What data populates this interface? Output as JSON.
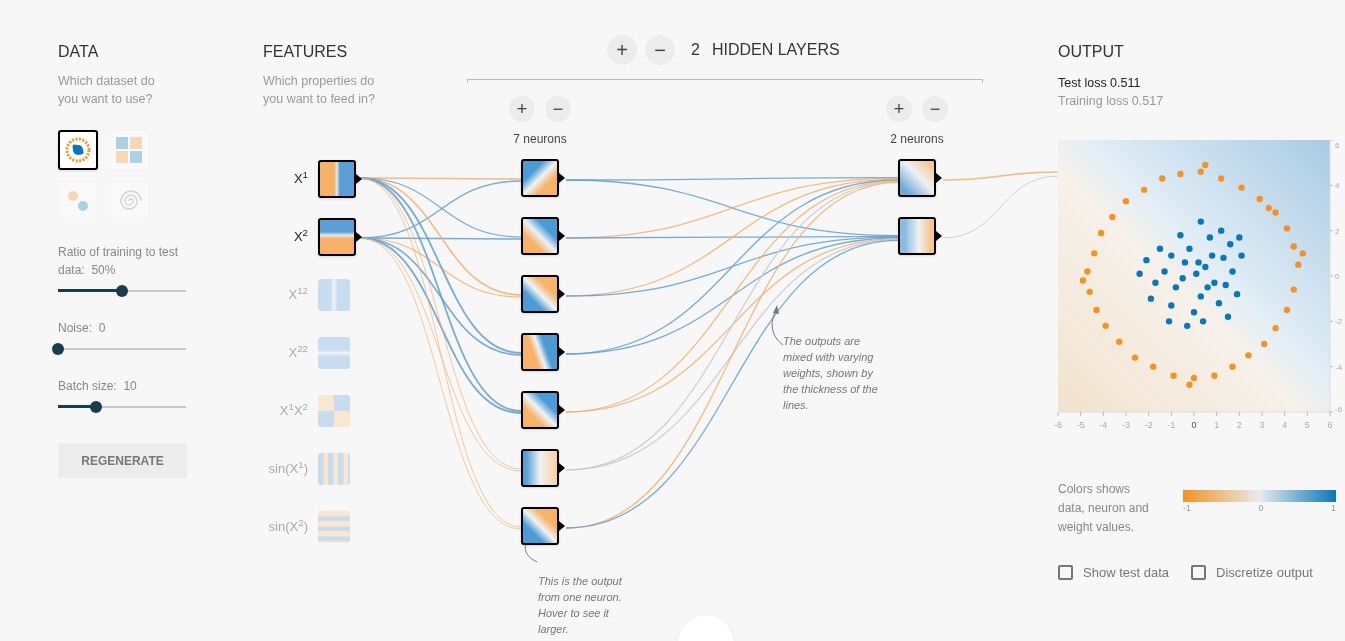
{
  "data": {
    "title": "DATA",
    "subtitle": "Which dataset do you want to use?",
    "datasets": [
      {
        "kind": "circle",
        "selected": true
      },
      {
        "kind": "xor",
        "selected": false
      },
      {
        "kind": "gauss",
        "selected": false
      },
      {
        "kind": "spiral",
        "selected": false
      }
    ],
    "sliders": [
      {
        "label": "Ratio of training to test data:",
        "value": "50%",
        "level": 0.5
      },
      {
        "label": "Noise:",
        "value": "0",
        "level": 0
      },
      {
        "label": "Batch size:",
        "value": "10",
        "level": 0.3
      }
    ],
    "regenerate_button": "REGENERATE"
  },
  "features": {
    "title": "FEATURES",
    "subtitle": "Which properties do you want to feed in?",
    "items": [
      {
        "label": "X$^{1}$",
        "kind": "x1",
        "selected": true
      },
      {
        "label": "X$^{2}$",
        "kind": "x2",
        "selected": true
      },
      {
        "label": "X$^{12}$",
        "kind": "x1sq",
        "selected": false
      },
      {
        "label": "X$^{22}$",
        "kind": "x2sq",
        "selected": false
      },
      {
        "label": "X$^{1}$X$^{2}$",
        "kind": "x1x2",
        "selected": false
      },
      {
        "label": "sin(X$^{1}$)",
        "kind": "sinx1",
        "selected": false
      },
      {
        "label": "sin(X$^{2}$)",
        "kind": "sinx2",
        "selected": false
      }
    ]
  },
  "network": {
    "add_layer": "+",
    "remove_layer": "−",
    "layer_count": "2",
    "title": "HIDDEN LAYERS",
    "layers": [
      {
        "add": "+",
        "remove": "−",
        "neurons_label": "7 neurons",
        "neurons": [
          {
            "kind": "nw-blue"
          },
          {
            "kind": "ne-blue"
          },
          {
            "kind": "sw-blue"
          },
          {
            "kind": "e-blue"
          },
          {
            "kind": "ne-blue"
          },
          {
            "kind": "w-blue"
          },
          {
            "kind": "sw-blue"
          }
        ]
      },
      {
        "add": "+",
        "remove": "−",
        "neurons_label": "2 neurons",
        "neurons": [
          {
            "kind": "sw-pale"
          },
          {
            "kind": "w-pale"
          }
        ]
      }
    ],
    "notes": [
      "This is the output from one neuron. Hover to see it larger.",
      "The outputs are mixed with varying weights, shown by the thickness of the lines."
    ]
  },
  "output": {
    "title": "OUTPUT",
    "test_loss": "Test loss 0.511",
    "training_loss": "Training loss 0.517",
    "chart_data": {
      "type": "scatter",
      "xlim": [
        -6,
        6
      ],
      "ylim": [
        -6,
        6
      ],
      "yticks": [
        -6,
        -4,
        -2,
        0,
        2,
        4,
        6
      ],
      "xticks": [
        -6,
        -5,
        -4,
        -3,
        -2,
        -1,
        0,
        1,
        2,
        3,
        4,
        5,
        6
      ],
      "series": [
        {
          "color": "#f59322",
          "x": [
            4.6,
            4.4,
            4.1,
            3.6,
            2.9,
            2.1,
            1.2,
            0.3,
            -0.6,
            -1.4,
            -2.2,
            -3.0,
            -3.6,
            -4.1,
            -4.4,
            -4.7,
            -4.6,
            -4.3,
            -3.9,
            -3.3,
            -2.6,
            -1.8,
            -0.9,
            0.0,
            0.9,
            1.7,
            2.4,
            3.1,
            3.6,
            4.1,
            4.4,
            4.8,
            -4.9,
            0.5,
            -0.2,
            3.3
          ],
          "values": [
            0.5,
            1.3,
            2.1,
            2.8,
            3.4,
            3.9,
            4.3,
            4.6,
            4.5,
            4.3,
            3.8,
            3.3,
            2.6,
            1.9,
            1.0,
            0.2,
            -0.7,
            -1.5,
            -2.2,
            -2.9,
            -3.6,
            -4.0,
            -4.4,
            -4.5,
            -4.4,
            -4.0,
            -3.5,
            -3.0,
            -2.3,
            -1.5,
            -0.6,
            1.0,
            -0.2,
            4.9,
            -4.8,
            3.0
          ]
        },
        {
          "color": "#0877bd",
          "x": [
            0.1,
            0.5,
            -0.4,
            0.9,
            -0.8,
            0.3,
            -0.2,
            1.3,
            -1.3,
            1.1,
            -1.0,
            0.0,
            1.7,
            -1.7,
            0.7,
            -0.6,
            1.6,
            -1.5,
            1.9,
            -1.9,
            0.4,
            -0.3,
            2.1,
            -2.1,
            1.2,
            -1.1,
            0.8,
            -0.5,
            0.2,
            0.6,
            -1.0,
            1.4,
            2.0,
            -2.4,
            0.3,
            1.5
          ],
          "values": [
            0.1,
            0.4,
            0.6,
            -0.3,
            -0.5,
            -0.9,
            1.2,
            0.8,
            0.2,
            -1.2,
            -1.3,
            -1.6,
            0.2,
            -0.3,
            1.7,
            1.8,
            1.4,
            1.2,
            -0.8,
            -1.0,
            -2.0,
            -2.2,
            0.9,
            0.7,
            2.0,
            -2.0,
            0.9,
            -0.1,
            0.6,
            -0.5,
            0.9,
            -0.4,
            1.7,
            0.1,
            2.4,
            -1.8
          ]
        }
      ]
    },
    "legend": {
      "text": "Colors shows data, neuron and weight values.",
      "ticks": [
        "-1",
        "0",
        "1"
      ]
    },
    "checkboxes": [
      {
        "label": "Show test data",
        "checked": false
      },
      {
        "label": "Discretize output",
        "checked": false
      }
    ]
  }
}
